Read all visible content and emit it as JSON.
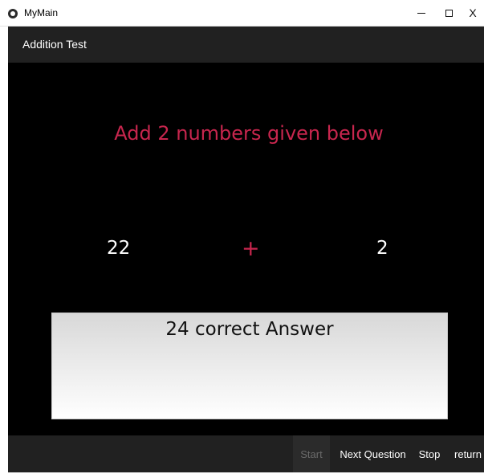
{
  "window": {
    "title": "MyMain",
    "controls": {
      "minimize": "–",
      "close": "X"
    }
  },
  "header": {
    "title": "Addition Test"
  },
  "question": {
    "prompt": "Add 2 numbers given below",
    "first_number": "22",
    "operator": "+",
    "second_number": "2"
  },
  "answer": {
    "text": "24 correct Answer"
  },
  "toolbar": {
    "start_label": "Start",
    "start_enabled": false,
    "next_label": "Next Question",
    "stop_label": "Stop",
    "return_label": "return"
  },
  "colors": {
    "accent": "#c8264e",
    "header_bg": "#212121",
    "content_bg": "#000000"
  }
}
